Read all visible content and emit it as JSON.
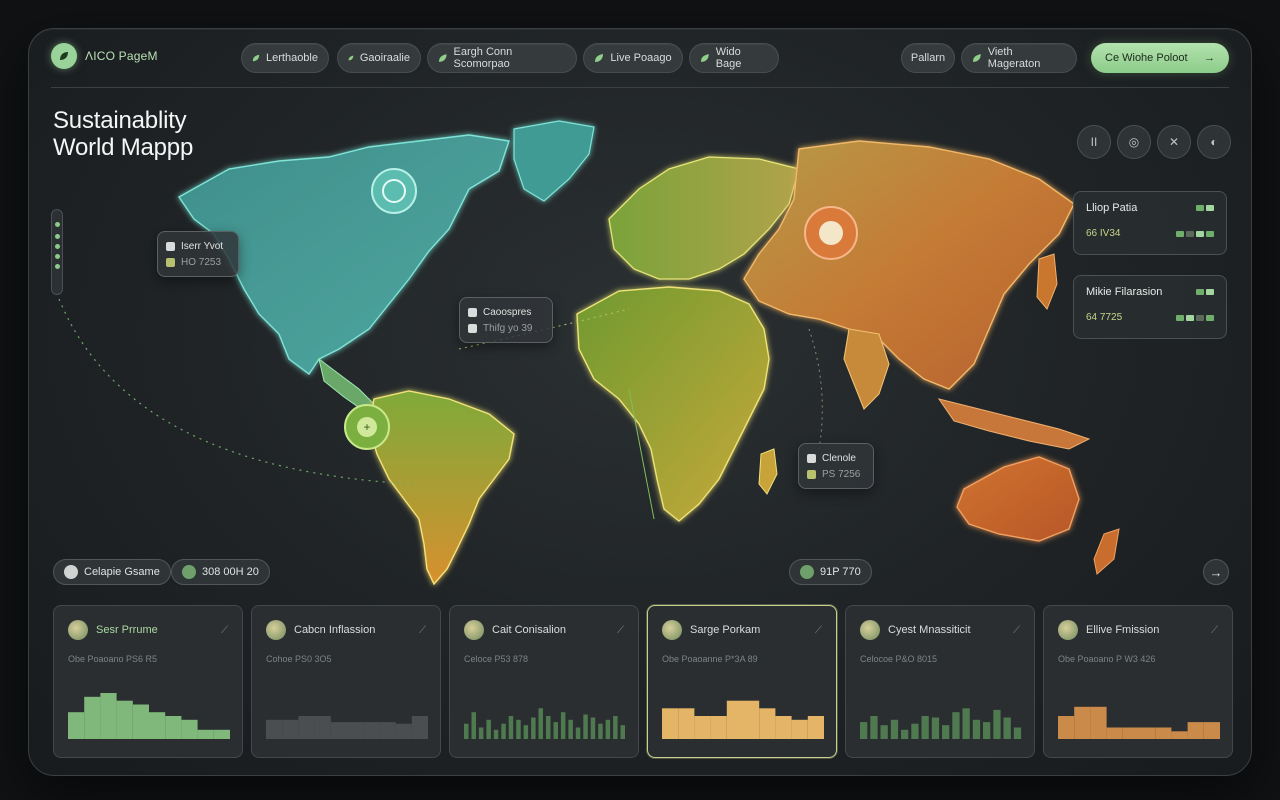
{
  "brand": {
    "name": "ΛICO PageM"
  },
  "nav": {
    "chips": [
      {
        "label": "Lerthaoble"
      },
      {
        "label": "Gaoiraalie"
      },
      {
        "label": "Eargh Conn Scomorpao"
      },
      {
        "label": "Live Poaago"
      },
      {
        "label": "Wido Bage"
      },
      {
        "label": "Pallarn"
      },
      {
        "label": "Vieth Mageraton"
      }
    ],
    "cta_label": "Ce Wiohe Poloot",
    "cta_arrow": "→"
  },
  "title": {
    "line1": "Sustainablity",
    "line2": "World Mappp"
  },
  "map_labels": {
    "card1": {
      "title": "Iserr Yvot",
      "sub": "HO 7253"
    },
    "card2": {
      "title": "Caoospres",
      "sub": "Thifg yo 39"
    },
    "card3": {
      "title": "Clenole",
      "sub": "PS 7256"
    }
  },
  "side_panels": [
    {
      "title": "Lliop Patia",
      "value": "66 IV34"
    },
    {
      "title": "Mikie Filarasion",
      "value": "64 7725"
    }
  ],
  "pills": {
    "left1": "Celapie Gsame",
    "left2": "308 00H 20",
    "mid": "91P 770",
    "arrow": "→"
  },
  "tool_buttons": [
    "II",
    "◎",
    "✕",
    "◐"
  ],
  "colors": {
    "green": "#8fc986",
    "teal": "#3fa39a",
    "yellow": "#d7c16a",
    "orange": "#d98639",
    "card_green": "#7fb87a",
    "card_grey": "#4a4e50",
    "card_yellow": "#e4b566",
    "card_orange": "#c98a4a"
  },
  "cards": [
    {
      "title": "Sesr Prrume",
      "sub": "Obe Poaoano PS6 R5",
      "color": "#7fb87a",
      "values": [
        35,
        55,
        60,
        50,
        45,
        35,
        30,
        25,
        12,
        12
      ]
    },
    {
      "title": "Cabcn Inflassion",
      "sub": "Cohoe PS0 3O5",
      "color": "#4a4e50",
      "values": [
        25,
        25,
        30,
        30,
        22,
        22,
        22,
        22,
        20,
        30
      ]
    },
    {
      "title": "Cait Conisalion",
      "sub": "Celoce P53 878",
      "color": "#4f7a4f",
      "values": [
        20,
        35,
        15,
        25,
        12,
        20,
        30,
        25,
        18,
        28,
        40,
        30,
        22,
        35,
        25,
        15,
        32,
        28,
        20,
        25,
        30,
        18
      ]
    },
    {
      "title": "Sarge Porkam",
      "sub": "Obe Poaoanne P*3A 89",
      "color": "#e4b566",
      "values": [
        40,
        40,
        30,
        30,
        50,
        50,
        40,
        30,
        25,
        30
      ]
    },
    {
      "title": "Cyest Mnassiticit",
      "sub": "Celocoe P&O 8015",
      "color": "#4f7a4f",
      "values": [
        22,
        30,
        18,
        25,
        12,
        20,
        30,
        28,
        18,
        35,
        40,
        25,
        22,
        38,
        28,
        15
      ]
    },
    {
      "title": "Ellive Fmission",
      "sub": "Obe Poaoano P W3 426",
      "color": "#c98a4a",
      "values": [
        30,
        42,
        42,
        15,
        15,
        15,
        15,
        10,
        22,
        22
      ]
    }
  ]
}
